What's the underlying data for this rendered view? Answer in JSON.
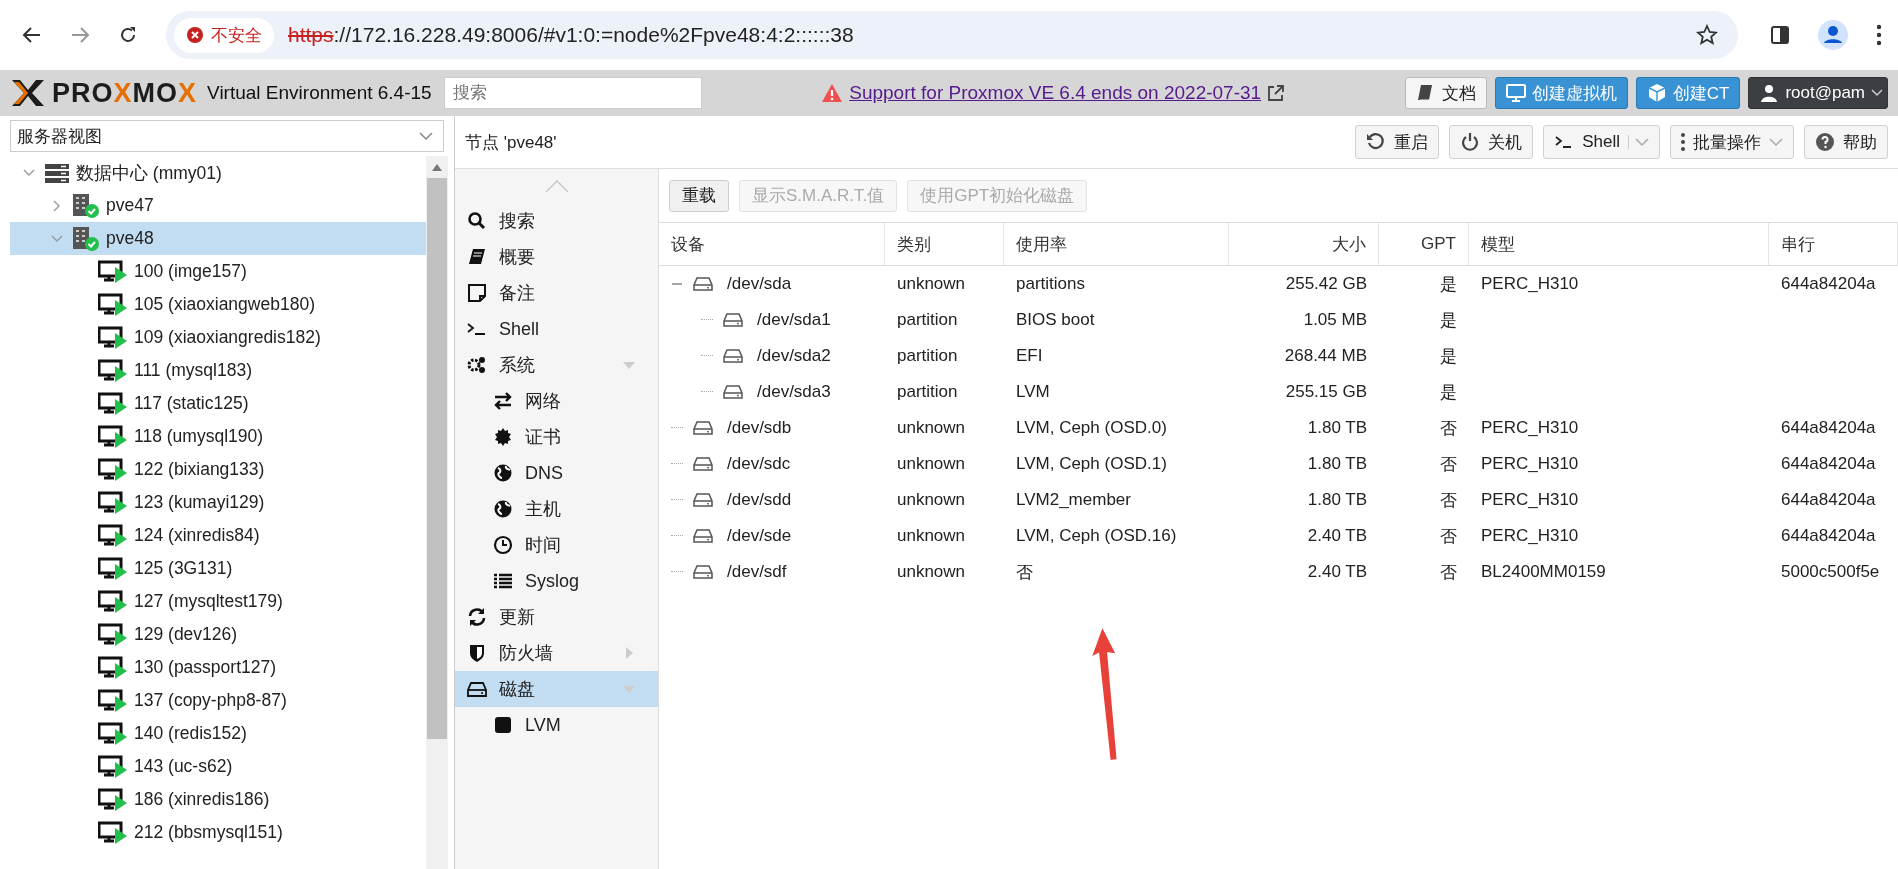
{
  "browser": {
    "security_label": "不安全",
    "url_scheme": "https",
    "url_rest": "://172.16.228.49:8006/#v1:0:=node%2Fpve48:4:2::::::38"
  },
  "header": {
    "logo": [
      {
        "text": "PRO",
        "accent": false
      },
      {
        "text": "X",
        "accent": true
      },
      {
        "text": "MO",
        "accent": false
      },
      {
        "text": "X",
        "accent": true
      }
    ],
    "version": "Virtual Environment 6.4-15",
    "search": {
      "placeholder": "搜索"
    },
    "notice": "Support for Proxmox VE 6.4 ends on 2022-07-31",
    "buttons": [
      {
        "label": "文档",
        "kind": "plain"
      },
      {
        "label": "创建虚拟机",
        "kind": "primary"
      },
      {
        "label": "创建CT",
        "kind": "primary"
      },
      {
        "label": "root@pam",
        "kind": "user"
      }
    ]
  },
  "sidebar": {
    "view_selector": "服务器视图",
    "tree": [
      {
        "label": "数据中心 (mmy01)",
        "kind": "datacenter",
        "expanded": true,
        "selected": false,
        "children": [
          {
            "label": "pve47",
            "kind": "node",
            "expanded": false,
            "selected": false
          },
          {
            "label": "pve48",
            "kind": "node",
            "expanded": true,
            "selected": true,
            "children": [
              {
                "label": "100 (imge157)",
                "kind": "vm",
                "running": true,
                "selected": false
              },
              {
                "label": "105 (xiaoxiangweb180)",
                "kind": "vm",
                "running": true,
                "selected": false
              },
              {
                "label": "109 (xiaoxiangredis182)",
                "kind": "vm",
                "running": true,
                "selected": false
              },
              {
                "label": "111 (mysql183)",
                "kind": "vm",
                "running": true,
                "selected": false
              },
              {
                "label": "117 (static125)",
                "kind": "vm",
                "running": true,
                "selected": false
              },
              {
                "label": "118 (umysql190)",
                "kind": "vm",
                "running": true,
                "selected": false
              },
              {
                "label": "122 (bixiang133)",
                "kind": "vm",
                "running": true,
                "selected": false
              },
              {
                "label": "123 (kumayi129)",
                "kind": "vm",
                "running": true,
                "selected": false
              },
              {
                "label": "124 (xinredis84)",
                "kind": "vm",
                "running": true,
                "selected": false
              },
              {
                "label": "125 (3G131)",
                "kind": "vm",
                "running": true,
                "selected": false
              },
              {
                "label": "127 (mysqltest179)",
                "kind": "vm",
                "running": true,
                "selected": false
              },
              {
                "label": "129 (dev126)",
                "kind": "vm",
                "running": true,
                "selected": false
              },
              {
                "label": "130 (passport127)",
                "kind": "vm",
                "running": true,
                "selected": false
              },
              {
                "label": "137 (copy-php8-87)",
                "kind": "vm",
                "running": true,
                "selected": false
              },
              {
                "label": "140 (redis152)",
                "kind": "vm",
                "running": true,
                "selected": false
              },
              {
                "label": "143 (uc-s62)",
                "kind": "vm",
                "running": true,
                "selected": false
              },
              {
                "label": "186 (xinredis186)",
                "kind": "vm",
                "running": true,
                "selected": false
              },
              {
                "label": "212 (bbsmysql151)",
                "kind": "vm",
                "running": true,
                "selected": false
              }
            ]
          }
        ]
      }
    ]
  },
  "node": {
    "title": "节点 'pve48'",
    "toolbar": [
      {
        "label": "重启",
        "kind": "plain"
      },
      {
        "label": "关机",
        "kind": "plain"
      },
      {
        "label": "Shell",
        "kind": "split"
      },
      {
        "label": "批量操作",
        "kind": "menu"
      },
      {
        "label": "帮助",
        "kind": "plain"
      }
    ]
  },
  "nav": [
    {
      "label": "搜索",
      "selected": false
    },
    {
      "label": "概要",
      "selected": false
    },
    {
      "label": "备注",
      "selected": false
    },
    {
      "label": "Shell",
      "selected": false
    },
    {
      "label": "系统",
      "selected": false,
      "expanded": true,
      "children": [
        {
          "label": "网络",
          "selected": false
        },
        {
          "label": "证书",
          "selected": false
        },
        {
          "label": "DNS",
          "selected": false
        },
        {
          "label": "主机",
          "selected": false
        },
        {
          "label": "时间",
          "selected": false
        },
        {
          "label": "Syslog",
          "selected": false
        }
      ]
    },
    {
      "label": "更新",
      "selected": false
    },
    {
      "label": "防火墙",
      "selected": false,
      "expanded": false
    },
    {
      "label": "磁盘",
      "selected": true,
      "expanded": true,
      "children": [
        {
          "label": "LVM",
          "selected": false
        }
      ]
    }
  ],
  "disks": {
    "toolbar": [
      {
        "label": "重载",
        "disabled": false
      },
      {
        "label": "显示S.M.A.R.T.值",
        "disabled": true
      },
      {
        "label": "使用GPT初始化磁盘",
        "disabled": true
      }
    ],
    "columns": [
      "设备",
      "类别",
      "使用率",
      "大小",
      "GPT",
      "模型",
      "串行"
    ],
    "rows": [
      {
        "device": "/dev/sda",
        "type": "unknown",
        "usage": "partitions",
        "size": "255.42 GB",
        "gpt": "是",
        "model": "PERC_H310",
        "serial": "644a84204a",
        "expanded": true,
        "children": [
          {
            "device": "/dev/sda1",
            "type": "partition",
            "usage": "BIOS boot",
            "size": "1.05 MB",
            "gpt": "是"
          },
          {
            "device": "/dev/sda2",
            "type": "partition",
            "usage": "EFI",
            "size": "268.44 MB",
            "gpt": "是"
          },
          {
            "device": "/dev/sda3",
            "type": "partition",
            "usage": "LVM",
            "size": "255.15 GB",
            "gpt": "是"
          }
        ]
      },
      {
        "device": "/dev/sdb",
        "type": "unknown",
        "usage": "LVM, Ceph (OSD.0)",
        "size": "1.80 TB",
        "gpt": "否",
        "model": "PERC_H310",
        "serial": "644a84204a"
      },
      {
        "device": "/dev/sdc",
        "type": "unknown",
        "usage": "LVM, Ceph (OSD.1)",
        "size": "1.80 TB",
        "gpt": "否",
        "model": "PERC_H310",
        "serial": "644a84204a"
      },
      {
        "device": "/dev/sdd",
        "type": "unknown",
        "usage": "LVM2_member",
        "size": "1.80 TB",
        "gpt": "否",
        "model": "PERC_H310",
        "serial": "644a84204a"
      },
      {
        "device": "/dev/sde",
        "type": "unknown",
        "usage": "LVM, Ceph (OSD.16)",
        "size": "2.40 TB",
        "gpt": "否",
        "model": "PERC_H310",
        "serial": "644a84204a"
      },
      {
        "device": "/dev/sdf",
        "type": "unknown",
        "usage": "否",
        "size": "2.40 TB",
        "gpt": "否",
        "model": "BL2400MM0159",
        "serial": "5000c500f5e"
      }
    ]
  },
  "annotation": {
    "kind": "arrow"
  }
}
